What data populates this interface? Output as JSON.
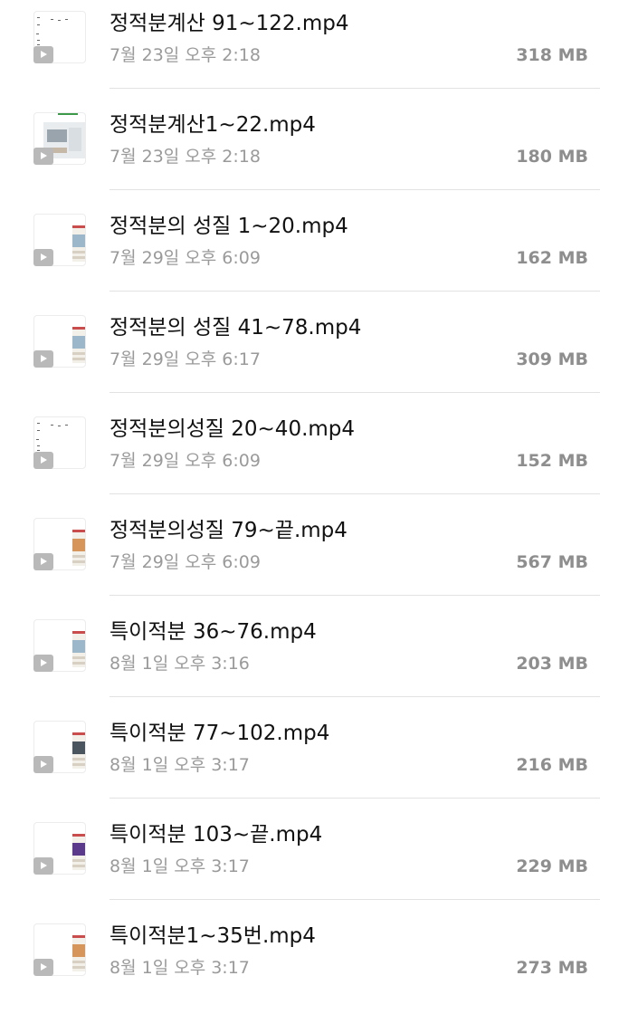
{
  "files": [
    {
      "name": "정적분계산 91~122.mp4",
      "date": "7월 23일 오후 2:18",
      "size": "318 MB",
      "thumb": "blank-dots"
    },
    {
      "name": "정적분계산1~22.mp4",
      "date": "7월 23일 오후 2:18",
      "size": "180 MB",
      "thumb": "screen"
    },
    {
      "name": "정적분의 성질 1~20.mp4",
      "date": "7월 29일 오후 6:09",
      "size": "162 MB",
      "thumb": "page"
    },
    {
      "name": "정적분의 성질 41~78.mp4",
      "date": "7월 29일 오후 6:17",
      "size": "309 MB",
      "thumb": "page"
    },
    {
      "name": "정적분의성질 20~40.mp4",
      "date": "7월 29일 오후 6:09",
      "size": "152 MB",
      "thumb": "blank-dots"
    },
    {
      "name": "정적분의성질 79~끝.mp4",
      "date": "7월 29일 오후 6:09",
      "size": "567 MB",
      "thumb": "page-orange"
    },
    {
      "name": "특이적분 36~76.mp4",
      "date": "8월 1일 오후 3:16",
      "size": "203 MB",
      "thumb": "page"
    },
    {
      "name": "특이적분 77~102.mp4",
      "date": "8월 1일 오후 3:17",
      "size": "216 MB",
      "thumb": "page-dark"
    },
    {
      "name": "특이적분 103~끝.mp4",
      "date": "8월 1일 오후 3:17",
      "size": "229 MB",
      "thumb": "page-purple"
    },
    {
      "name": "특이적분1~35번.mp4",
      "date": "8월 1일 오후 3:17",
      "size": "273 MB",
      "thumb": "page-orange"
    }
  ],
  "colors": {
    "name": "#111111",
    "date": "#9a9a9a",
    "size": "#8e8e8e",
    "divider": "#e2e2e2",
    "play_badge": "#b9b9b9"
  },
  "icons": {
    "play": "play-icon"
  }
}
